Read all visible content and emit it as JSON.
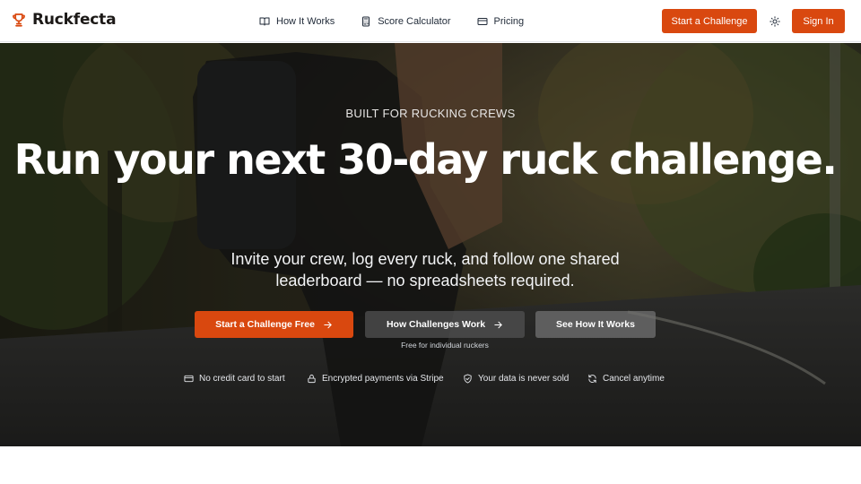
{
  "header": {
    "brand_name": "Ruckfecta",
    "nav": [
      {
        "label": "How It Works",
        "icon": "book-open-icon"
      },
      {
        "label": "Score Calculator",
        "icon": "calculator-icon"
      },
      {
        "label": "Pricing",
        "icon": "credit-card-icon"
      }
    ],
    "cta_label": "Start a Challenge",
    "signin_label": "Sign In"
  },
  "hero": {
    "eyebrow": "BUILT FOR RUCKING CREWS",
    "headline": "Run your next 30-day ruck challenge.",
    "subhead_line1": "Invite your crew, log every ruck, and follow one shared",
    "subhead_line2": "leaderboard — no spreadsheets required.",
    "primary_cta": "Start a Challenge Free",
    "secondary_cta": "How Challenges Work",
    "tertiary_cta": "See How It Works",
    "cta_note": "Free for individual ruckers",
    "trust": [
      {
        "label": "No credit card to start",
        "icon": "credit-card-icon"
      },
      {
        "label": "Encrypted payments via Stripe",
        "icon": "lock-icon"
      },
      {
        "label": "Your data is never sold",
        "icon": "shield-check-icon"
      },
      {
        "label": "Cancel anytime",
        "icon": "refresh-icon"
      }
    ]
  },
  "colors": {
    "accent": "#d9480f",
    "text_dark": "#1f2937",
    "hero_text": "#ffffff"
  }
}
